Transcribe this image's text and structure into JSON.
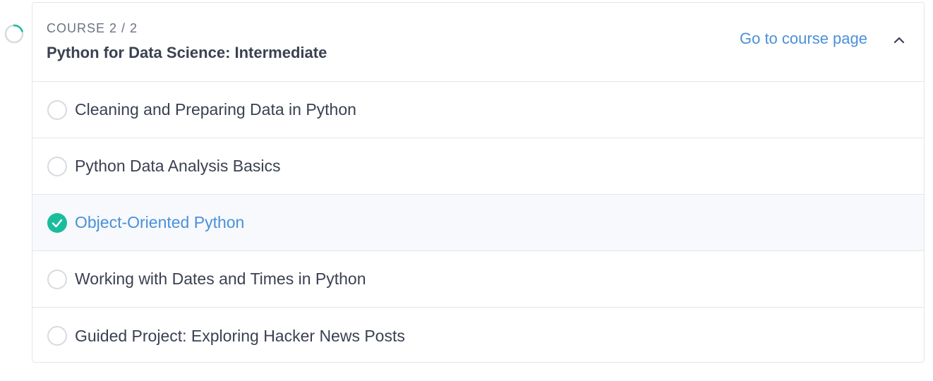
{
  "course": {
    "eyebrow": "COURSE 2 / 2",
    "title": "Python for Data Science: Intermediate",
    "link_label": "Go to course page",
    "progress_fraction": 0.2
  },
  "lessons": [
    {
      "label": "Cleaning and Preparing Data in Python",
      "completed": false
    },
    {
      "label": "Python Data Analysis Basics",
      "completed": false
    },
    {
      "label": "Object-Oriented Python",
      "completed": true
    },
    {
      "label": "Working with Dates and Times in Python",
      "completed": false
    },
    {
      "label": "Guided Project: Exploring Hacker News Posts",
      "completed": false
    }
  ],
  "colors": {
    "accent": "#4a90d9",
    "success": "#1abc9c",
    "ring_track": "#d7dbe0",
    "text": "#3a4151",
    "muted": "#6b7280"
  },
  "icons": {
    "progress": "progress-ring-icon",
    "collapse": "chevron-up-icon",
    "complete": "check-circle-icon",
    "incomplete": "empty-circle-icon"
  }
}
